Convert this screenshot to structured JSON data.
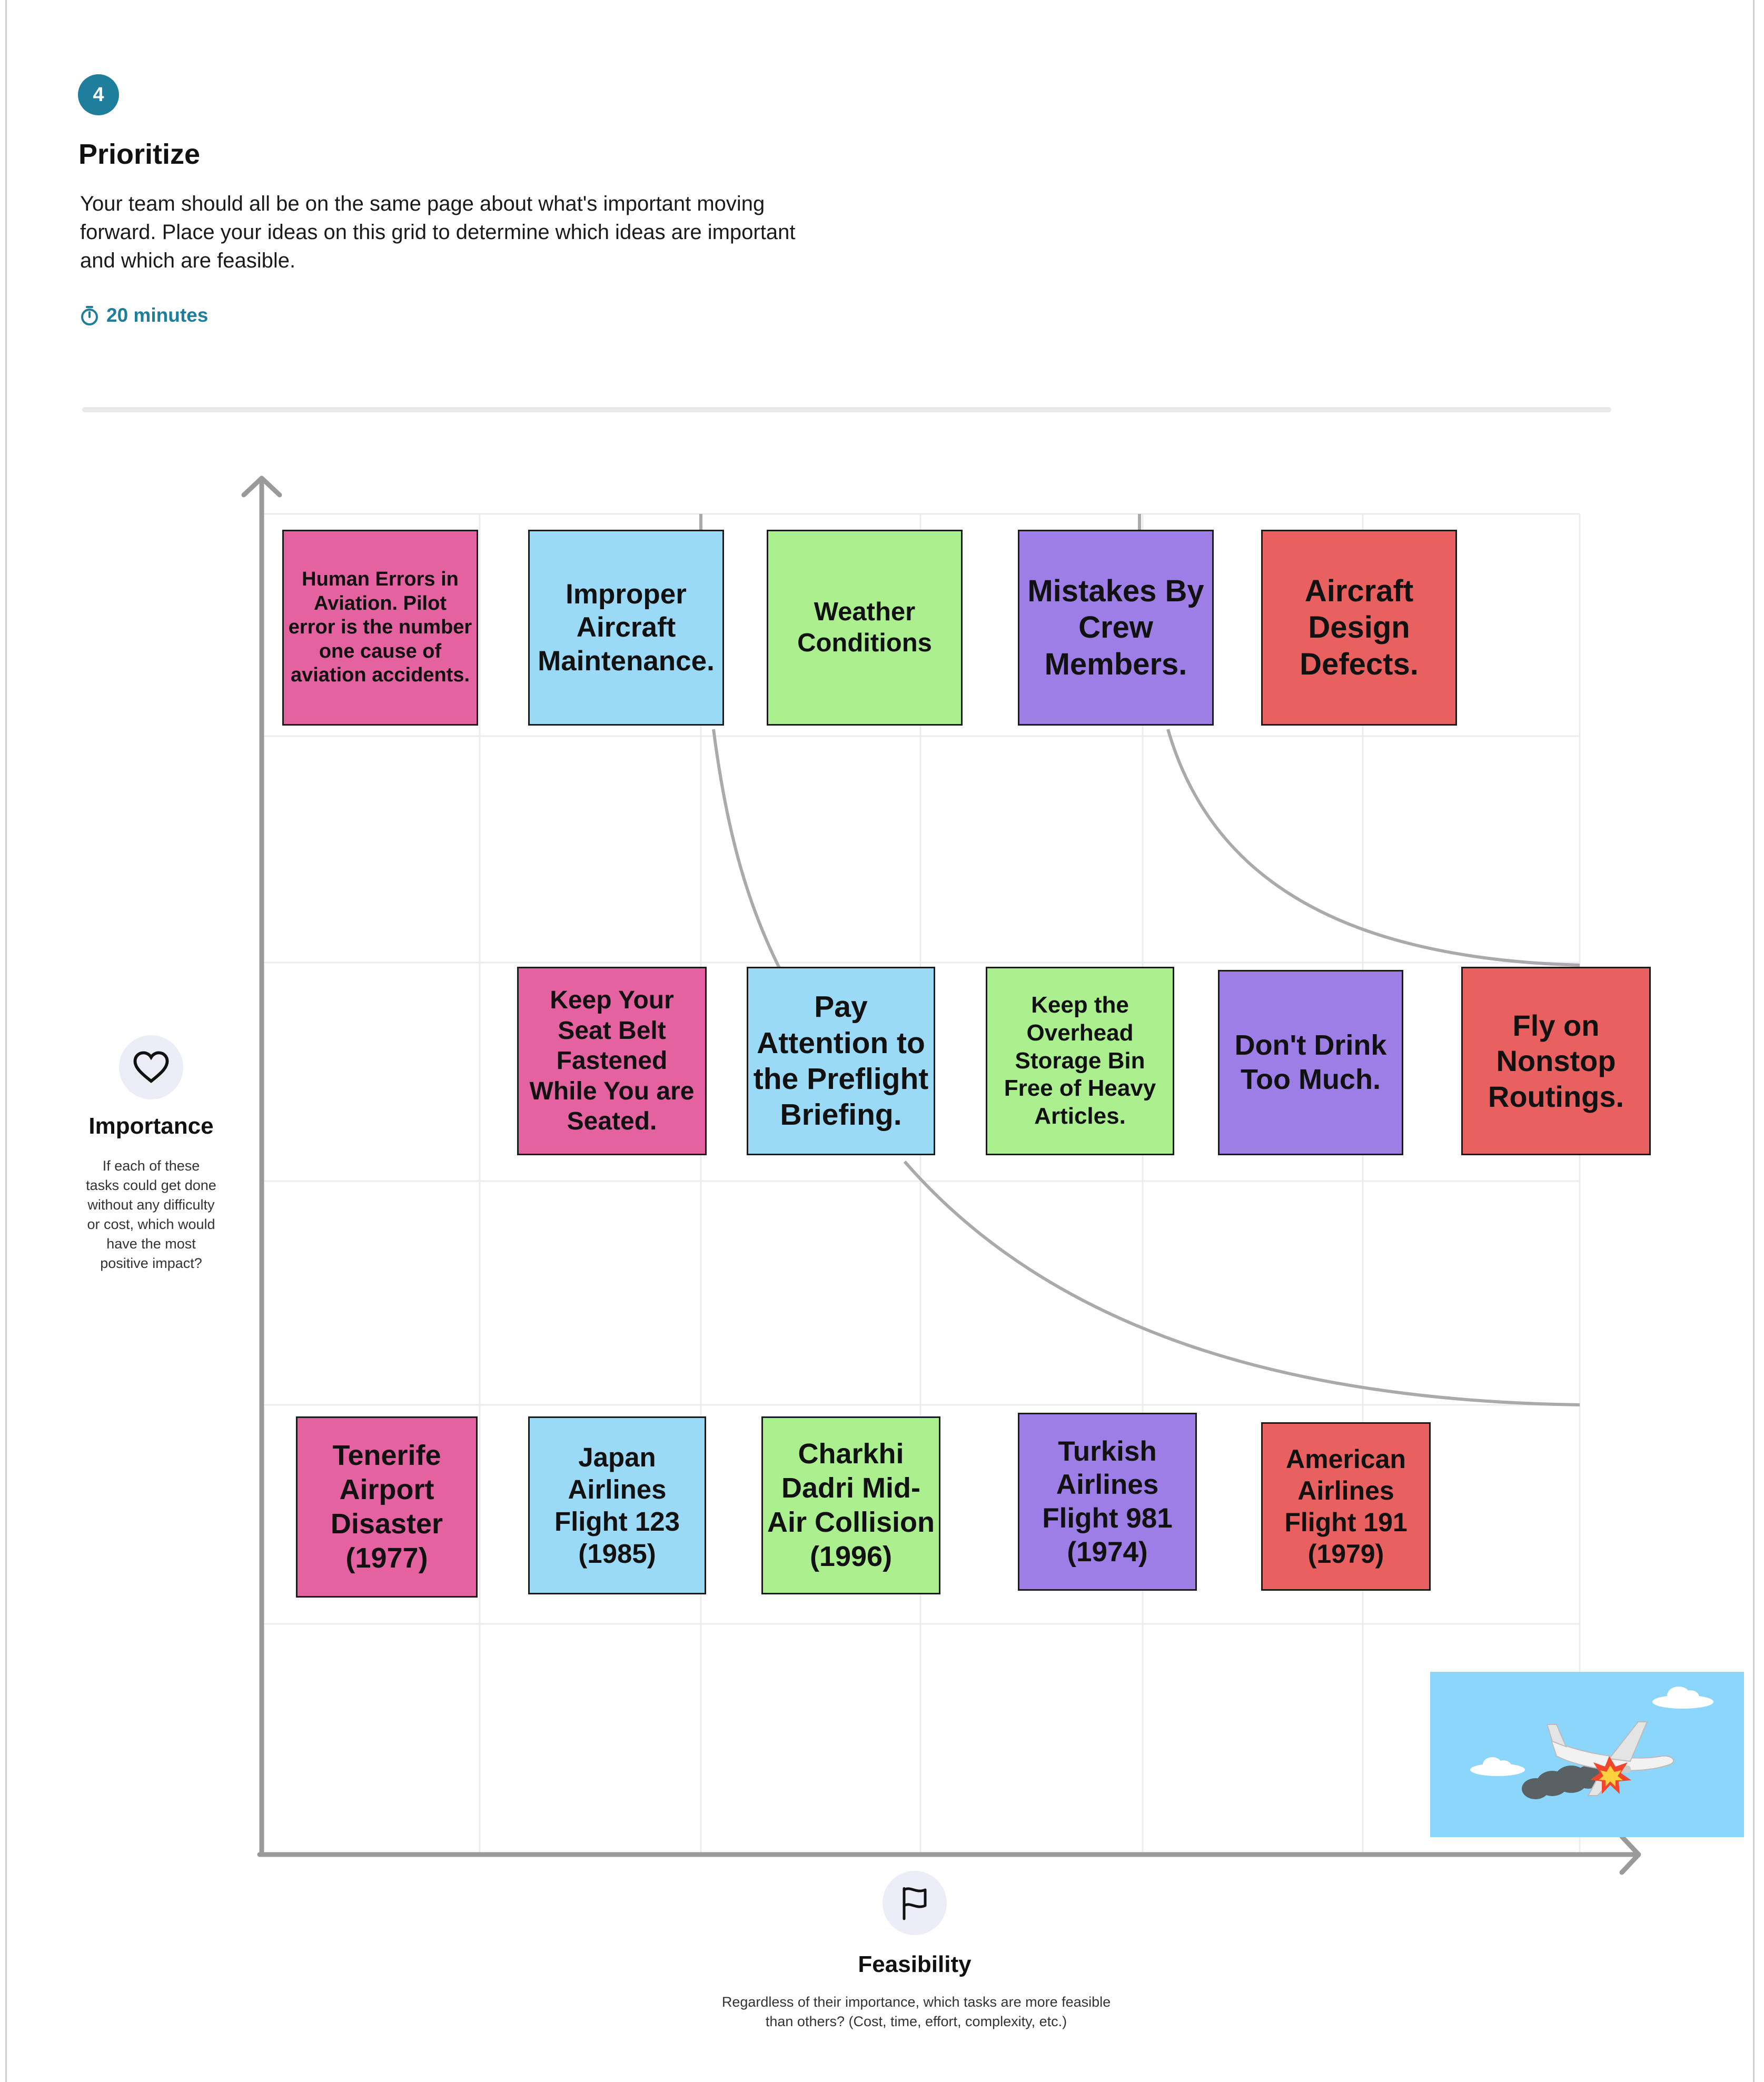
{
  "step": {
    "number": "4",
    "title": "Prioritize",
    "description": "Your team should all be on the same page about what's important moving forward. Place your ideas on this grid to determine which ideas are important and which are feasible.",
    "timer": "20 minutes"
  },
  "axes": {
    "importance": {
      "title": "Importance",
      "description": "If each of these tasks could get done without any difficulty or cost, which would have the most positive impact?",
      "icon": "heart-icon"
    },
    "feasibility": {
      "title": "Feasibility",
      "description": "Regardless of their importance, which tasks are more feasible than others? (Cost, time, effort, complexity, etc.)",
      "icon": "flag-icon"
    }
  },
  "notes": {
    "row1": [
      {
        "text": "Human Errors in Aviation. Pilot error is the number one cause of aviation accidents.",
        "color": "#e4629f"
      },
      {
        "text": "Improper Aircraft Maintenance.",
        "color": "#9bdaf6"
      },
      {
        "text": "Weather Conditions",
        "color": "#abef8f"
      },
      {
        "text": "Mistakes By Crew Members.",
        "color": "#9d7de6"
      },
      {
        "text": "Aircraft Design Defects.",
        "color": "#e96060"
      }
    ],
    "row2": [
      {
        "text": "Keep Your Seat Belt Fastened While You are Seated.",
        "color": "#e4629f"
      },
      {
        "text": "Pay Attention to the Preflight Briefing.",
        "color": "#9bdaf6"
      },
      {
        "text": "Keep the Overhead Storage Bin Free of Heavy Articles.",
        "color": "#abef8f"
      },
      {
        "text": "Don't Drink Too Much.",
        "color": "#9d7de6"
      },
      {
        "text": "Fly on Nonstop Routings.",
        "color": "#e96060"
      }
    ],
    "row3": [
      {
        "text": "Tenerife Airport Disaster (1977)",
        "color": "#e4629f"
      },
      {
        "text": "Japan Airlines Flight 123 (1985)",
        "color": "#9bdaf6"
      },
      {
        "text": "Charkhi Dadri Mid-Air Collision (1996)",
        "color": "#abef8f"
      },
      {
        "text": "Turkish Airlines Flight 981 (1974)",
        "color": "#9d7de6"
      },
      {
        "text": "American Airlines Flight 191 (1979)",
        "color": "#e96060"
      }
    ]
  },
  "illustration": {
    "name": "crashing-airplane-illustration",
    "sky_color": "#8dd6fb"
  }
}
